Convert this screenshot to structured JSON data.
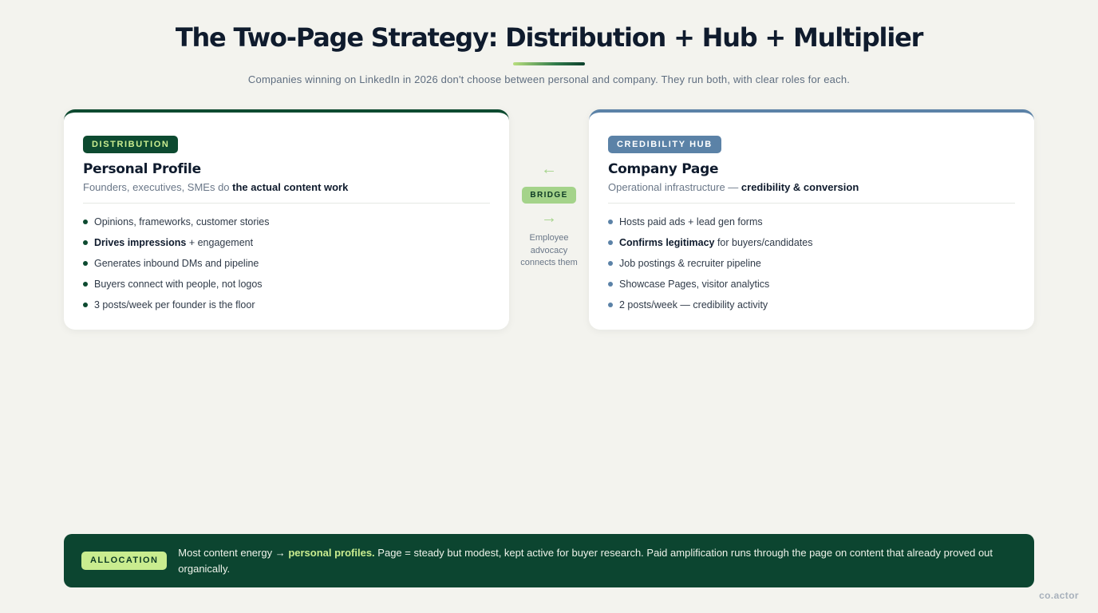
{
  "header": {
    "title": "The Two-Page Strategy: Distribution + Hub + Multiplier",
    "subtitle": "Companies winning on LinkedIn in 2026 don't choose between personal and company. They run both, with clear roles for each."
  },
  "left_card": {
    "badge": "DISTRIBUTION",
    "title": "Personal Profile",
    "desc_prefix": "Founders, executives, SMEs do ",
    "desc_bold": "the actual content work",
    "points": [
      {
        "bold": "",
        "text": "Opinions, frameworks, customer stories"
      },
      {
        "bold": "Drives impressions",
        "text": " + engagement"
      },
      {
        "bold": "",
        "text": "Generates inbound DMs and pipeline"
      },
      {
        "bold": "",
        "text": "Buyers connect with people, not logos"
      },
      {
        "bold": "",
        "text": "3 posts/week per founder is the floor"
      }
    ]
  },
  "bridge": {
    "arrow_left": "←",
    "label": "BRIDGE",
    "arrow_right": "→",
    "note": "Employee advocacy connects them"
  },
  "right_card": {
    "badge": "CREDIBILITY HUB",
    "title": "Company Page",
    "desc_prefix": "Operational infrastructure — ",
    "desc_bold": "credibility & conversion",
    "points": [
      {
        "bold": "",
        "text": "Hosts paid ads + lead gen forms"
      },
      {
        "bold": "Confirms legitimacy",
        "text": " for buyers/candidates"
      },
      {
        "bold": "",
        "text": "Job postings & recruiter pipeline"
      },
      {
        "bold": "",
        "text": "Showcase Pages, visitor analytics"
      },
      {
        "bold": "",
        "text": "2 posts/week — credibility activity"
      }
    ]
  },
  "allocation": {
    "badge": "ALLOCATION",
    "text_before": "Most content energy → ",
    "highlight": "personal profiles.",
    "text_after": " Page = steady but modest, kept active for buyer research. Paid amplification runs through the page on content that already proved out organically."
  },
  "brand": "co.actor",
  "colors": {
    "background": "#f3f3ee",
    "distribution": "#0d4a30",
    "credibility": "#5b82a7",
    "accent_lime": "#c9ec8f",
    "bridge_green": "#a4d38a"
  }
}
